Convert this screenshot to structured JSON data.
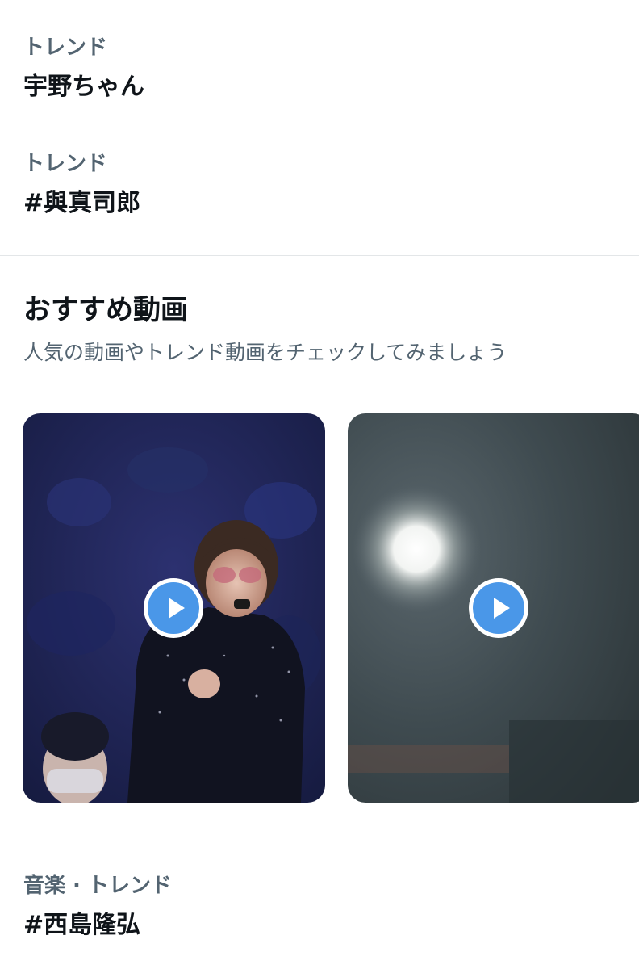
{
  "trends": [
    {
      "context": "トレンド",
      "name": "宇野ちゃん"
    },
    {
      "context": "トレンド",
      "name": "#與真司郎"
    }
  ],
  "recommended_videos": {
    "title": "おすすめ動画",
    "subtitle": "人気の動画やトレンド動画をチェックしてみましょう",
    "play_button_color": "#4a97e8",
    "videos": [
      {
        "thumbnail": "concert-performer-on-stage"
      },
      {
        "thumbnail": "dim-stage-spotlight"
      }
    ]
  },
  "trends_after": [
    {
      "context": "音楽 · トレンド",
      "name": "#西島隆弘"
    }
  ],
  "colors": {
    "primary_text": "#0f1419",
    "secondary_text": "#536471",
    "divider": "#e3e6e8"
  }
}
